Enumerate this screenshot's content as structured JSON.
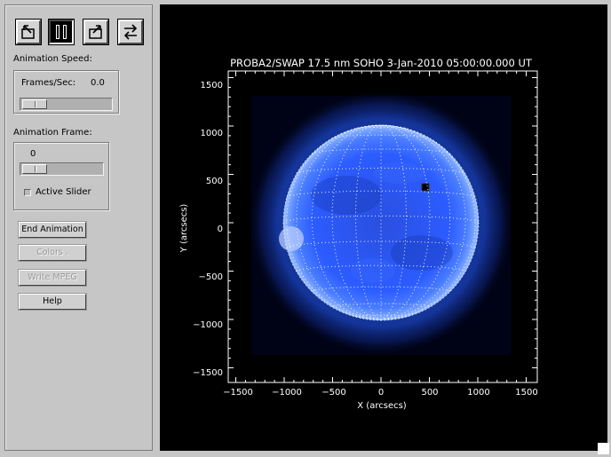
{
  "toolbar": {
    "buttons": [
      {
        "name": "step-back-button",
        "icon": "step-back-icon"
      },
      {
        "name": "pause-button",
        "icon": "pause-icon",
        "pressed": true
      },
      {
        "name": "step-forward-button",
        "icon": "step-forward-icon"
      },
      {
        "name": "cycle-direction-button",
        "icon": "cycle-direction-icon"
      }
    ]
  },
  "speed": {
    "title": "Animation Speed:",
    "frames_label": "Frames/Sec:",
    "frames_value": "0.0"
  },
  "frame": {
    "title": "Animation Frame:",
    "value": "0",
    "active_slider_label": "Active Slider"
  },
  "buttons": {
    "end_animation": "End Animation",
    "colors": "Colors .",
    "write_mpeg": "Write MPEG",
    "help": "Help"
  },
  "plot": {
    "title": "PROBA2/SWAP 17.5 nm SOHO  3-Jan-2010 05:00:00.000 UT",
    "xlabel": "X (arcsecs)",
    "ylabel": "Y (arcsecs)",
    "x_ticks": [
      "−1500",
      "−1000",
      "−500",
      "0",
      "500",
      "1000",
      "1500"
    ],
    "y_ticks": [
      "1500",
      "1000",
      "500",
      "0",
      "−500",
      "−1000",
      "−1500"
    ],
    "colors": {
      "background": "#000000",
      "axes": "#ffffff",
      "sun": "#2c5cff",
      "grid": "#ffffff"
    }
  }
}
